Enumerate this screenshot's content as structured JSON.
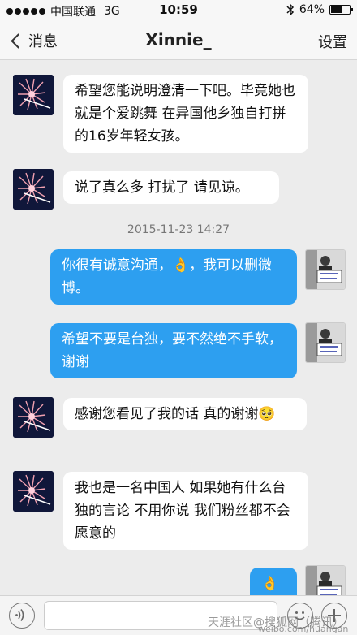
{
  "status_bar": {
    "carrier": "中国联通",
    "network": "3G",
    "time": "10:59",
    "battery": "64%",
    "battery_level": 0.64,
    "signal_bars": 5
  },
  "nav": {
    "back_label": "消息",
    "title": "Xinnie_",
    "settings_label": "设置"
  },
  "messages": [
    {
      "side": "left",
      "text": "希望您能说明澄清一下吧。毕竟她也就是个爱跳舞 在异国他乡独自打拼的16岁年轻女孩。"
    },
    {
      "side": "left",
      "text": "说了真么多 打扰了 请见谅。"
    },
    {
      "type": "timestamp",
      "text": "2015-11-23 14:27"
    },
    {
      "side": "right",
      "text": "你很有诚意沟通，👌，我可以删微博。"
    },
    {
      "side": "right",
      "text": "希望不要是台独，要不然绝不手软，谢谢"
    },
    {
      "side": "left",
      "text": "感谢您看见了我的话 真的谢谢🥺"
    },
    {
      "side": "left",
      "text": "我也是一名中国人 如果她有什么台独的言论 不用你说 我们粉丝都不会愿意的"
    },
    {
      "side": "right",
      "text": "👌"
    }
  ],
  "input": {
    "value": "",
    "placeholder": ""
  },
  "icons": {
    "voice": "voice-icon",
    "emoji": "emoji-icon",
    "plus": "plus-icon",
    "back": "chevron-left-icon",
    "bluetooth": "bluetooth-icon"
  },
  "watermark": {
    "line1": "天涯社区@搜狐网（腾讯）",
    "line2": "weibo.com/huangan"
  },
  "colors": {
    "bubble_right": "#2d9ff0",
    "bubble_left": "#ffffff",
    "background": "#ececec"
  }
}
